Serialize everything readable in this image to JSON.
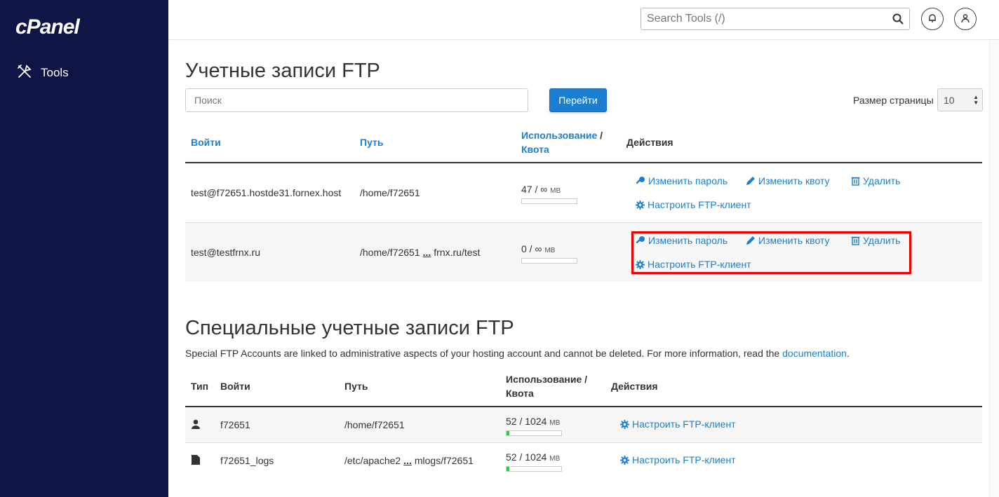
{
  "sidebar": {
    "logo": "cPanel",
    "items": [
      {
        "label": "Tools",
        "icon": "tools-icon"
      }
    ]
  },
  "topbar": {
    "search_placeholder": "Search Tools (/)"
  },
  "page": {
    "title": "Учетные записи FTP",
    "filter_placeholder": "Поиск",
    "go_button": "Перейти",
    "page_size_label": "Размер страницы",
    "page_size_value": "10"
  },
  "ftp_table": {
    "headers": {
      "login": "Войти",
      "path": "Путь",
      "usage": "Использование",
      "slash": "/",
      "quota": "Квота",
      "actions": "Действия"
    },
    "action_labels": {
      "change_password": "Изменить пароль",
      "change_quota": "Изменить квоту",
      "delete": "Удалить",
      "configure": "Настроить FTP-клиент"
    },
    "rows": [
      {
        "login": "test@f72651.hostde31.fornex.host",
        "path_start": "/home/f72651",
        "path_ellipsis": "",
        "path_end": "",
        "usage": "47 / ∞",
        "unit": "MB",
        "usage_fraction": 0
      },
      {
        "login": "test@testfrnx.ru",
        "path_start": "/home/f72651",
        "path_ellipsis": "...",
        "path_end": "frnx.ru/test",
        "usage": "0 / ∞",
        "unit": "MB",
        "usage_fraction": 0
      }
    ]
  },
  "special": {
    "title": "Специальные учетные записи FTP",
    "desc": "Special FTP Accounts are linked to administrative aspects of your hosting account and cannot be deleted. For more information, read the ",
    "desc_link": "documentation",
    "desc_end": ".",
    "headers": {
      "type": "Тип",
      "login": "Войти",
      "path": "Путь",
      "usage": "Использование /",
      "quota": "Квота",
      "actions": "Действия"
    },
    "configure": "Настроить FTP-клиент",
    "rows": [
      {
        "type_icon": "user-icon",
        "login": "f72651",
        "path_start": "/home/f72651",
        "path_ellipsis": "",
        "path_end": "",
        "usage": "52 / 1024",
        "unit": "MB",
        "usage_fraction": 0.05
      },
      {
        "type_icon": "file-icon",
        "login": "f72651_logs",
        "path_start": "/etc/apache2",
        "path_ellipsis": "...",
        "path_end": "mlogs/f72651",
        "usage": "52 / 1024",
        "unit": "MB",
        "usage_fraction": 0.05
      }
    ]
  },
  "colors": {
    "sidebar_bg": "#0f1545",
    "link": "#1a7fd0",
    "highlight": "#e00000",
    "usage_fill": "#2ecc40"
  }
}
